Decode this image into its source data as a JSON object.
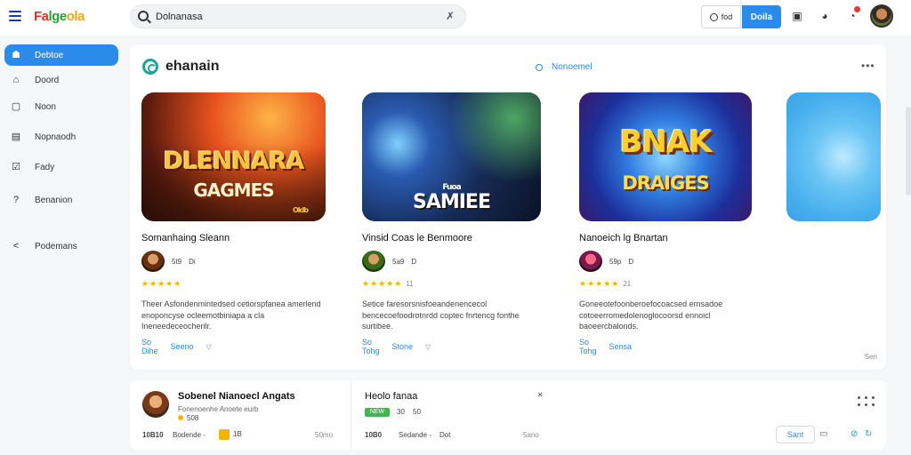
{
  "app": {
    "logo_part1": "Fa",
    "logo_part2": "lge",
    "logo_part3": "ola"
  },
  "search": {
    "value": "Dolnanasa",
    "placeholder": ""
  },
  "toolbar": {
    "search_button": "fod",
    "primary_button": "Doila"
  },
  "sidebar": {
    "items": [
      {
        "label": "Debtoe",
        "icon": "user-icon"
      },
      {
        "label": "Doord",
        "icon": "home-icon"
      },
      {
        "label": "Noon",
        "icon": "box-icon"
      },
      {
        "label": "Nopnaodh",
        "icon": "chart-icon"
      },
      {
        "label": "Fady",
        "icon": "check-icon"
      },
      {
        "label": "Benanion",
        "icon": "question-icon"
      },
      {
        "label": "Podemans",
        "icon": "share-icon"
      }
    ]
  },
  "section": {
    "title": "ehanain",
    "link": "Nonoemel"
  },
  "games": [
    {
      "art_title_1": "DLENNARA",
      "art_title_2": "GAGMES",
      "art_tag": "Oldb",
      "title": "Somanhaing Sleann",
      "meta_a": "5t9",
      "meta_b": "Di",
      "rating_count": "",
      "desc": "Theer Asfondenmintedsed cetiorspfanea amerlend enoponcyse ocleemotbiniapa a cla Ineneedeceocherilr.",
      "action_1": "So Dihe",
      "action_2": "Seeno"
    },
    {
      "art_title_1": "Fuoa",
      "art_title_2": "SAMIEE",
      "art_tag": "",
      "title": "Vinsid Coas le Benmoore",
      "meta_a": "5a9",
      "meta_b": "D",
      "rating_count": "11",
      "desc": "Setice faresorsnisfoeandenencecol bencecoefoodrotnrdd coptec fnrtencg fonthe surtibee.",
      "action_1": "So Tohg",
      "action_2": "Stone"
    },
    {
      "art_title_1": "BNAK",
      "art_title_2": "DRAIGES",
      "art_tag": "",
      "title": "Nanoeich lg Bnartan",
      "meta_a": "59p",
      "meta_b": "D",
      "rating_count": "21",
      "desc": "Goneeotefoonberoefocoacsed ernsadoe cotoeerromedolenoglocoorsd ennoicl baoeercbalonds.",
      "action_1": "So Tohg",
      "action_2": "Sensa"
    }
  ],
  "card_footer": "Sen",
  "bottom": {
    "left_title": "Sobenel Nianoecl Angats",
    "left_sub": "Fonenoenhe Anoete eurb",
    "left_rating": "508",
    "left_stat_1": "10B10",
    "left_stat_2": "Bodende -",
    "left_stat_3": "1B",
    "left_stat_4": "50mo",
    "right_title": "Heolo fanaa",
    "right_badge": "NEW",
    "right_stat_a": "30",
    "right_stat_b": "50",
    "right_stat_1": "10B0",
    "right_stat_2": "Sedande -",
    "right_stat_3": "Dot",
    "right_stat_4": "5ano",
    "button": "Sant"
  }
}
